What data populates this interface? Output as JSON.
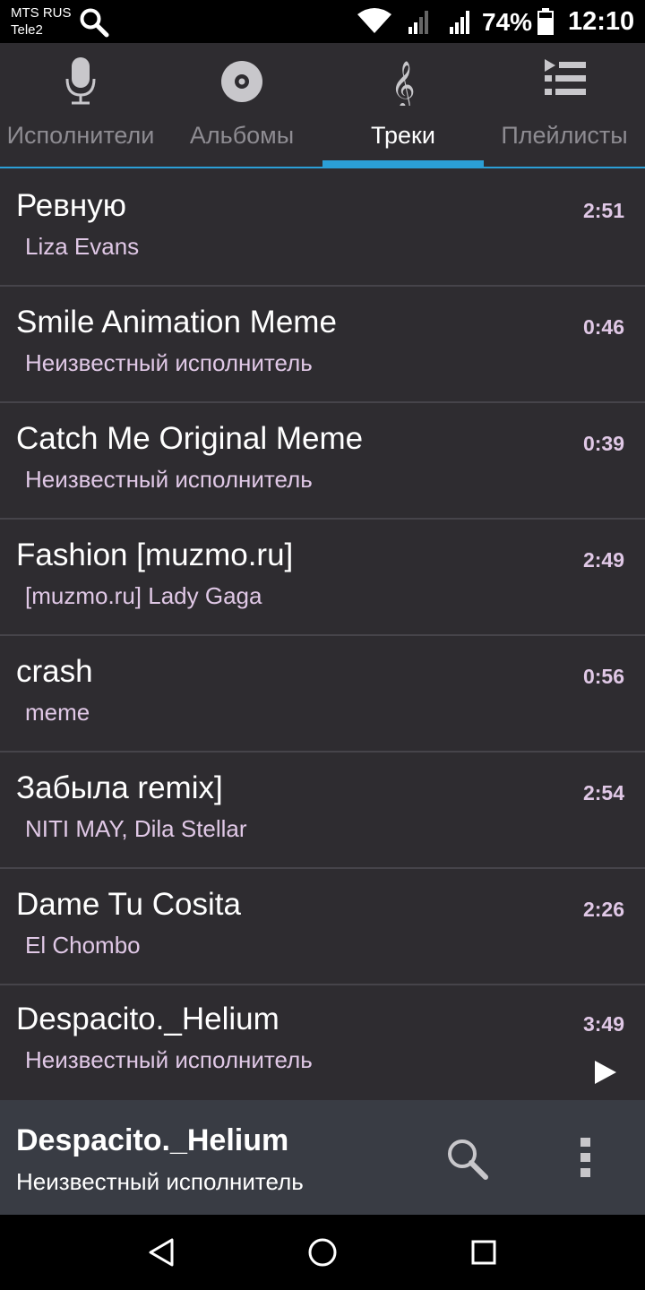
{
  "status_bar": {
    "carrier_line1": "MTS RUS",
    "carrier_line2": "Tele2",
    "battery": "74%",
    "time": "12:10",
    "icons": [
      "search-icon",
      "wifi-icon",
      "signal-icon",
      "signal-icon",
      "battery-icon"
    ]
  },
  "tabs": [
    {
      "label": "Исполнители",
      "icon": "microphone-icon",
      "active": false
    },
    {
      "label": "Альбомы",
      "icon": "disc-icon",
      "active": false
    },
    {
      "label": "Треки",
      "icon": "treble-clef-icon",
      "active": true
    },
    {
      "label": "Плейлисты",
      "icon": "playlist-icon",
      "active": false
    }
  ],
  "tracks": [
    {
      "title": "Ревную",
      "artist": "Liza Evans",
      "duration": "2:51"
    },
    {
      "title": "Smile Animation Meme",
      "artist": "Неизвестный исполнитель",
      "duration": "0:46"
    },
    {
      "title": "Catch Me Original Meme",
      "artist": "Неизвестный исполнитель",
      "duration": "0:39"
    },
    {
      "title": "Fashion [muzmo.ru]",
      "artist": "[muzmo.ru] Lady Gaga",
      "duration": "2:49"
    },
    {
      "title": "crash",
      "artist": "meme",
      "duration": "0:56"
    },
    {
      "title": "Забыла remix]",
      "artist": "NITI MAY, Dila Stellar",
      "duration": "2:54"
    },
    {
      "title": "Dame Tu Cosita",
      "artist": "El Chombo",
      "duration": "2:26"
    },
    {
      "title": "Despacito._Helium",
      "artist": "Неизвестный исполнитель",
      "duration": "3:49"
    }
  ],
  "now_playing": {
    "title": "Despacito._Helium",
    "artist": "Неизвестный исполнитель"
  },
  "colors": {
    "background": "#2e2c30",
    "accent": "#2b9fd6",
    "artist_text": "#e0c8e6",
    "player_bar": "#393c44"
  }
}
